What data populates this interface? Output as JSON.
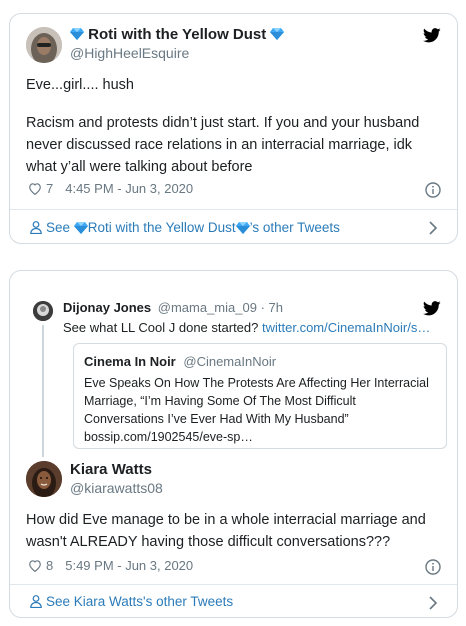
{
  "tweet1": {
    "author_name": "Roti with the Yellow Dust",
    "author_handle": "@HighHeelEsquire",
    "text_line1": "Eve...girl.... hush",
    "text_line2": "Racism and protests didn’t just start. If you and your husband never discussed race relations in an interracial marriage, idk what y’all were talking about before",
    "likes": "7",
    "timestamp": "4:45 PM - Jun 3, 2020",
    "footer_prefix": "See ",
    "footer_name": "Roti with the Yellow Dust",
    "footer_suffix": "’s other Tweets"
  },
  "tweet2": {
    "parent": {
      "author_name": "Dijonay Jones",
      "author_handle": "@mama_mia_09",
      "separator": "·",
      "age": "7h",
      "text": "See what LL Cool J done started?",
      "link": "twitter.com/CinemaInNoir/s…"
    },
    "quoted": {
      "author_name": "Cinema In Noir",
      "author_handle": "@CinemaInNoir",
      "text": "Eve Speaks On How The Protests Are Affecting Her Interracial Marriage, “I’m Having Some Of The Most Difficult Conversations I’ve Ever Had With My Husband” bossip.com/1902545/eve-sp…"
    },
    "author_name": "Kiara Watts",
    "author_handle": "@kiarawatts08",
    "text": "How did Eve manage to be in a whole interracial marriage and wasn't ALREADY having those difficult conversations???",
    "likes": "8",
    "timestamp": "5:49 PM - Jun 3, 2020",
    "footer": "See Kiara Watts's other Tweets"
  },
  "colors": {
    "twitter_blue": "#1da1f2",
    "link": "#2b7bb9",
    "muted": "#697882",
    "gem": "#3fa9f5"
  },
  "icons": [
    "twitter-bird-icon",
    "heart-icon",
    "info-icon",
    "person-icon",
    "chevron-right-icon",
    "gem-icon"
  ]
}
